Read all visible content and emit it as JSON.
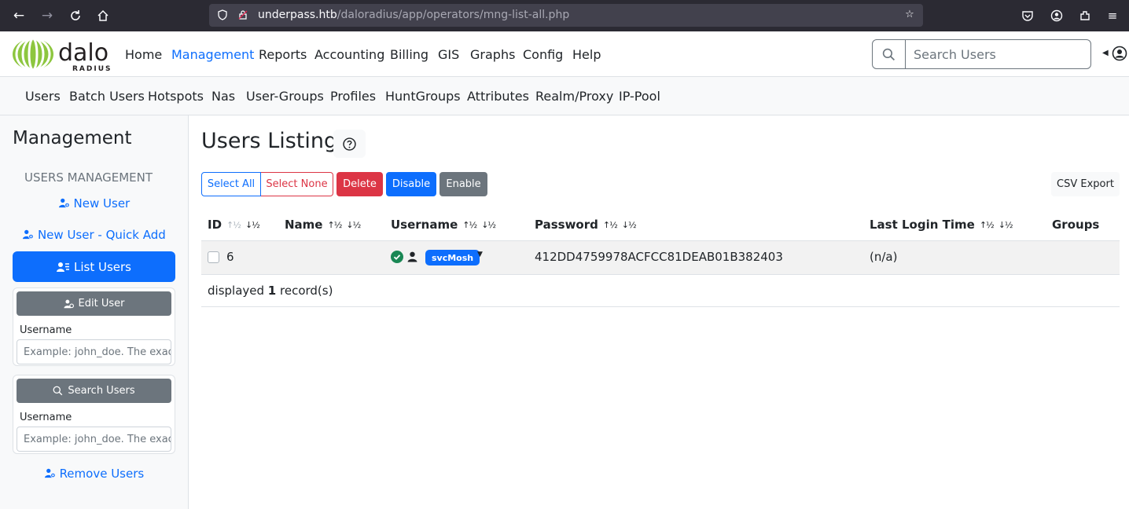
{
  "browser": {
    "url_host": "underpass.htb",
    "url_path": "/daloradius/app/operators/mng-list-all.php"
  },
  "navbar": {
    "logo_text_top": "dalo",
    "logo_text_bottom": "RADIUS",
    "items": [
      "Home",
      "Management",
      "Reports",
      "Accounting",
      "Billing",
      "GIS",
      "Graphs",
      "Config",
      "Help"
    ],
    "active_item": "Management",
    "search_placeholder": "Search Users"
  },
  "subnav": {
    "items": [
      "Users",
      "Batch Users",
      "Hotspots",
      "Nas",
      "User-Groups",
      "Profiles",
      "HuntGroups",
      "Attributes",
      "Realm/Proxy",
      "IP-Pool"
    ]
  },
  "sidebar": {
    "title": "Management",
    "section": "USERS MANAGEMENT",
    "new_user": "New User",
    "quick_add": "New User - Quick Add",
    "list_users": "List Users",
    "edit_user": {
      "button": "Edit User",
      "label": "Username",
      "placeholder": "Example: john_doe. The exact username"
    },
    "search_users": {
      "button": "Search Users",
      "label": "Username",
      "placeholder": "Example: john_doe. The exact username"
    },
    "remove_users": "Remove Users"
  },
  "main": {
    "title": "Users Listing",
    "actions": {
      "select_all": "Select All",
      "select_none": "Select None",
      "delete": "Delete",
      "disable": "Disable",
      "enable": "Enable",
      "csv_export": "CSV Export"
    },
    "table": {
      "headers": [
        "ID",
        "Name",
        "Username",
        "Password",
        "Last Login Time",
        "Groups"
      ],
      "rows": [
        {
          "id": "6",
          "name": "",
          "username": "svcMosh",
          "password": "412DD4759978ACFCC81DEAB01B382403",
          "last_login": "(n/a)",
          "groups": ""
        }
      ]
    },
    "footer": {
      "prefix": "displayed",
      "count": "1",
      "suffix": "record(s)"
    }
  },
  "colors": {
    "primary": "#0d6efd",
    "danger": "#dc3545",
    "secondary": "#6c757d",
    "success": "#198754",
    "logo_green": "#8dc63f"
  }
}
